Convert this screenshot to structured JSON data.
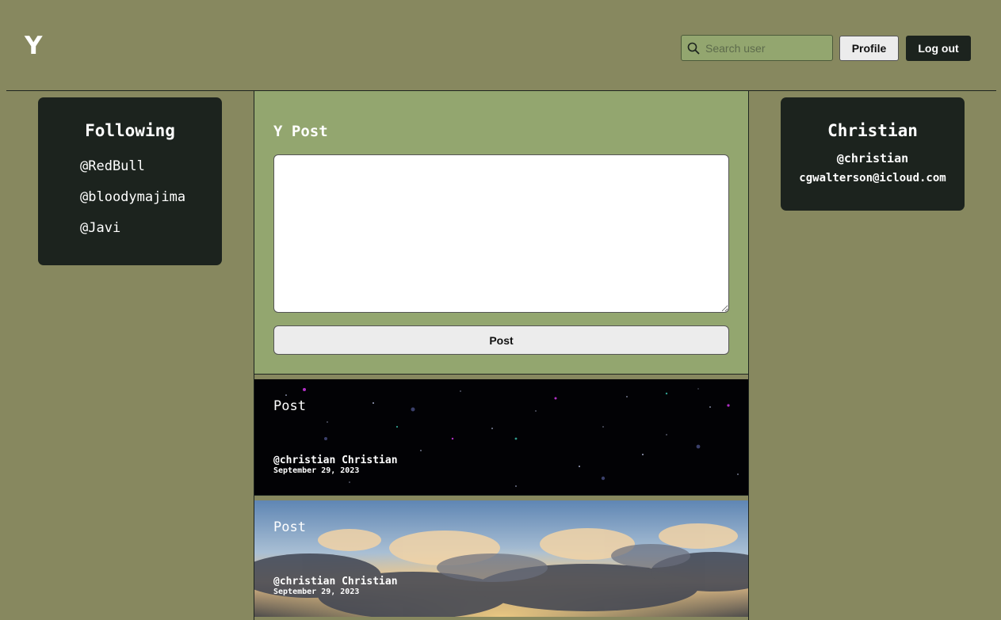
{
  "header": {
    "logo": "Y",
    "search_placeholder": "Search user",
    "profile_label": "Profile",
    "logout_label": "Log out"
  },
  "following": {
    "title": "Following",
    "users": [
      "@RedBull",
      "@bloodymajima",
      "@Javi"
    ]
  },
  "profile": {
    "name": "Christian",
    "handle": "@christian",
    "email": "cgwalterson@icloud.com"
  },
  "composer": {
    "title": "Y Post",
    "textarea_value": "",
    "post_label": "Post"
  },
  "posts": [
    {
      "title": "Post",
      "author": "@christian Christian",
      "date": "September 29, 2023",
      "background": "starfield"
    },
    {
      "title": "Post",
      "author": "@christian Christian",
      "date": "September 29, 2023",
      "background": "sunset-clouds"
    }
  ],
  "colors": {
    "page_bg": "#87885f",
    "panel_green": "#93a66f",
    "card_dark": "#1c231e"
  }
}
